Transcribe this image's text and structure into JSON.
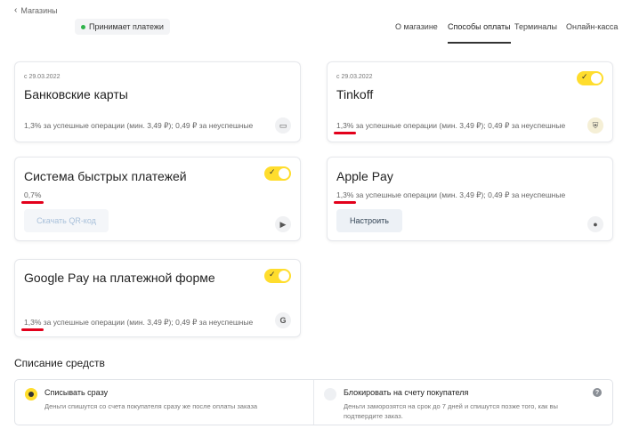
{
  "back": {
    "label": "Магазины"
  },
  "status": {
    "label": "Принимает платежи"
  },
  "tabs": [
    {
      "label": "О магазине"
    },
    {
      "label": "Способы оплаты"
    },
    {
      "label": "Терминалы"
    },
    {
      "label": "Онлайн-касса"
    }
  ],
  "cards": {
    "bank": {
      "since": "с 29.03.2022",
      "title": "Банковские карты",
      "fee": "1,3% за успешные операции (мин. 3,49 ₽); 0,49 ₽ за неуспешные"
    },
    "tinkoff": {
      "since": "с 29.03.2022",
      "title": "Tinkoff",
      "pct": "1,3%",
      "fee_rest": " за успешные операции (мин. 3,49 ₽); 0,49 ₽ за неуспешные"
    },
    "sbp": {
      "title": "Система быстрых платежей",
      "pct": "0,7%",
      "button": "Скачать QR-код"
    },
    "apple": {
      "title": "Apple Pay",
      "pct": "1,3%",
      "fee_rest": " за успешные операции (мин. 3,49 ₽); 0,49 ₽ за неуспешные",
      "button": "Настроить"
    },
    "google": {
      "title": "Google Pay на платежной форме",
      "pct": "1,3%",
      "fee_rest": " за успешные операции (мин. 3,49 ₽); 0,49 ₽ за неуспешные"
    }
  },
  "charge": {
    "title": "Списание средств",
    "options": [
      {
        "label": "Списывать сразу",
        "desc": "Деньги спишутся со счета покупателя сразу же после оплаты заказа"
      },
      {
        "label": "Блокировать на счету покупателя",
        "desc": "Деньги заморозятся на срок до 7 дней и спишутся позже того, как вы подтвердите заказ."
      }
    ]
  },
  "colors": {
    "accent": "#ffdd2d",
    "underline": "#e3001b",
    "status_dot": "#2fb34a"
  }
}
